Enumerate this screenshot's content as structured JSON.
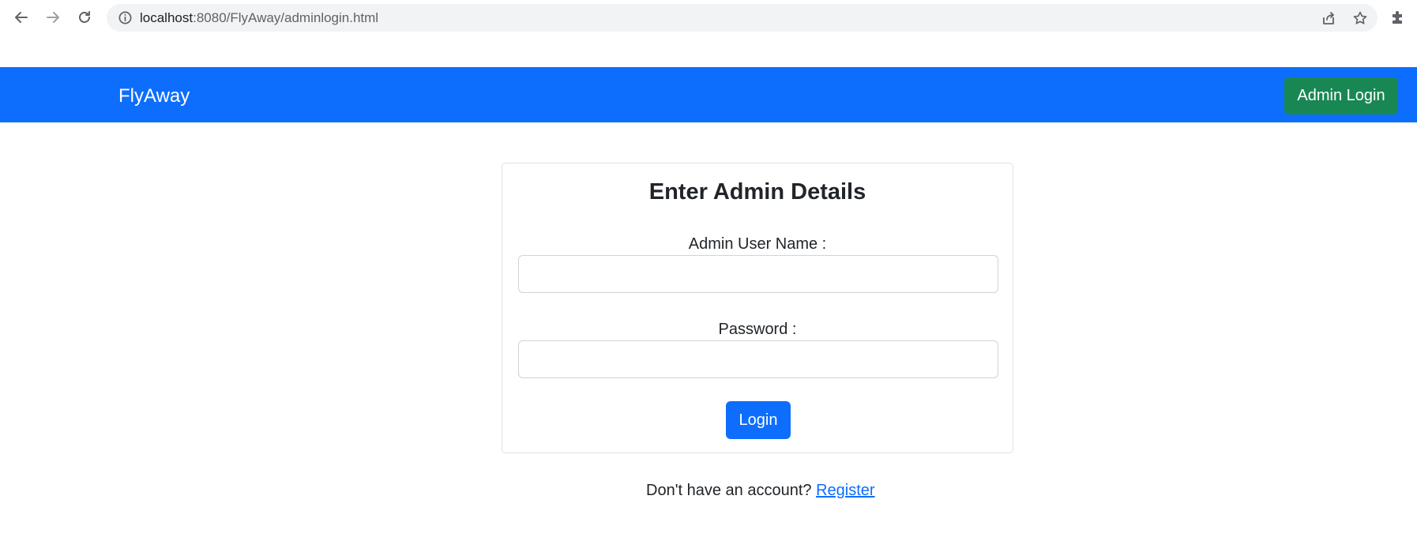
{
  "browser": {
    "url_host": "localhost",
    "url_path": ":8080/FlyAway/adminlogin.html",
    "icons": [
      "back-arrow-icon",
      "forward-arrow-icon",
      "reload-icon",
      "info-icon",
      "share-icon",
      "star-icon",
      "puzzle-extension-icon"
    ]
  },
  "navbar": {
    "brand": "FlyAway",
    "admin_login_label": "Admin Login",
    "background_color": "#0d6efd",
    "admin_button_color": "#198754"
  },
  "login_card": {
    "title": "Enter Admin Details",
    "username_label": "Admin User Name :",
    "username_value": "",
    "password_label": "Password :",
    "password_value": "",
    "login_label": "Login"
  },
  "footer": {
    "prompt": "Don't have an account?",
    "register_label": "Register"
  }
}
